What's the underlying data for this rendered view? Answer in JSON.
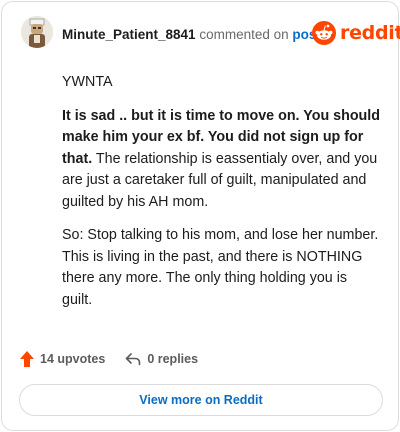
{
  "header": {
    "author": "Minute_Patient_8841",
    "commented_on": "commented on",
    "post_link": "post",
    "brand": "reddit",
    "brand_color": "#ff4500"
  },
  "comment": {
    "p1": "YWNTA",
    "p2_bold": "It is sad .. but it is time to move on. You should make him your ex bf. You did not sign up for that.",
    "p2_rest": " The relationship is eassentialy over, and you are just a caretaker full of guilt, manipulated and guilted by his AH mom.",
    "p3": "So: Stop talking to his mom, and lose her number. This is living in the past, and there is NOTHING there any more. The only thing holding you is guilt."
  },
  "actions": {
    "upvotes": "14 upvotes",
    "replies": "0 replies",
    "upvote_icon": "upvote-arrow-icon",
    "reply_icon": "reply-arrow-icon",
    "upvote_color": "#ff4500"
  },
  "footer": {
    "view_more": "View more on Reddit"
  }
}
